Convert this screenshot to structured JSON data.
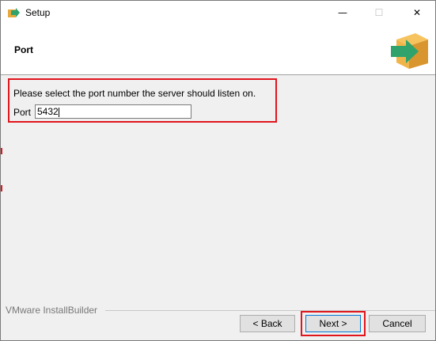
{
  "window": {
    "title": "Setup",
    "controls": {
      "minimize": "—",
      "maximize": "☐",
      "close": "✕"
    }
  },
  "header": {
    "title": "Port",
    "logo_icon": "installer-box-arrow-icon"
  },
  "content": {
    "prompt": "Please select the port number the server should listen on.",
    "port_label": "Port",
    "port_value": "5432"
  },
  "footer": {
    "branding": "VMware InstallBuilder",
    "back_label": "< Back",
    "next_label": "Next >",
    "cancel_label": "Cancel"
  },
  "colors": {
    "highlight": "#e0151d",
    "logo_green": "#2fa36b",
    "logo_box": "#f0b54a"
  }
}
